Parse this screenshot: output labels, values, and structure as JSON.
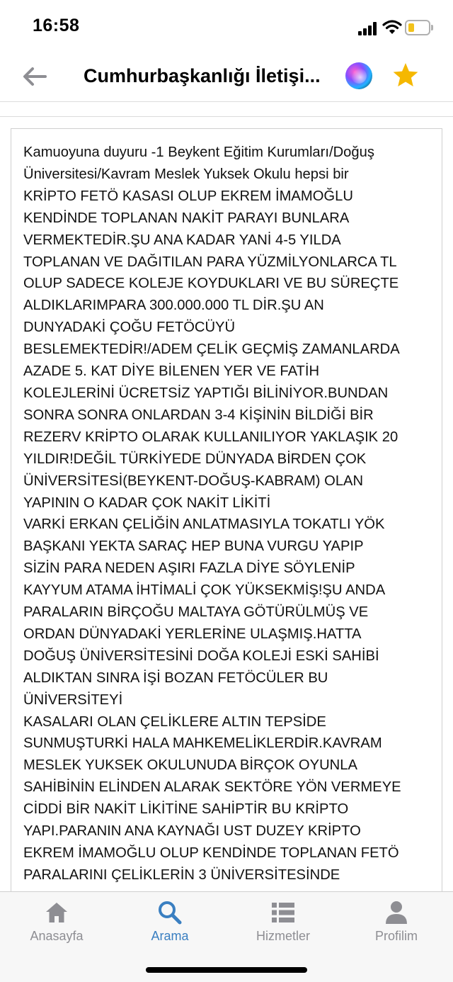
{
  "status_bar": {
    "time": "16:58",
    "battery_color": "#f2c21b"
  },
  "nav": {
    "back_icon": "back-arrow-icon",
    "title": "Cumhurbaşkanlığı İletişi...",
    "siri_icon": "siri-icon",
    "favorite_icon": "star-icon",
    "star_color": "#f5b800"
  },
  "content": {
    "text": "Kamuoyuna duyuru -1 Beykent Eğitim Kurumları/Doğuş\nÜniversitesi/Kavram Meslek Yuksek Okulu hepsi bir\nKRİPTO FETÖ KASASI OLUP EKREM İMAMOĞLU\nKENDİNDE TOPLANAN NAKİT PARAYI BUNLARA\nVERMEKTEDİR.ŞU ANA KADAR YANİ 4-5 YILDA\nTOPLANAN VE DAĞITILAN PARA YÜZMİLYONLARCA TL\nOLUP SADECE KOLEJE KOYDUKLARI VE BU SÜREÇTE\nALDIKLARIMPARA 300.000.000 TL DİR.ŞU AN\nDUNYADAKİ ÇOĞU FETÖCÜYÜ\nBESLEMEKTEDİR!/ADEM ÇELİK GEÇMİŞ ZAMANLARDA\nAZADE 5. KAT DİYE BİLENEN YER VE FATİH\nKOLEJLERİNİ ÜCRETSİZ YAPTIĞI BİLİNİYOR.BUNDAN\nSONRA SONRA ONLARDAN 3-4 KİŞİNİN BİLDİĞİ BİR\nREZERV KRİPTO OLARAK KULLANILIYOR YAKLAŞIK 20\nYILDIR!DEĞİL TÜRKİYEDE DÜNYADA BİRDEN ÇOK\nÜNİVERSİTESİ(BEYKENT-DOĞUŞ-KABRAM) OLAN\nYAPININ O KADAR ÇOK NAKİT LİKİTİ\nVARKİ ERKAN ÇELİĞİN ANLATMASIYLA TOKATLI YÖK\nBAŞKANI YEKTA SARAÇ HEP BUNA VURGU YAPIP\nSİZİN PARA NEDEN AŞIRI FAZLA DİYE SÖYLENİP\nKAYYUM ATAMA İHTİMALİ ÇOK YÜKSEKMİŞ!ŞU ANDA\nPARALARIN BİRÇOĞU MALTAYA GÖTÜRÜLMÜŞ VE\nORDAN DÜNYADAKİ YERLERİNE ULAŞMIŞ.HATTA\nDOĞUŞ ÜNİVERSİTESİNİ DOĞA KOLEJİ ESKİ SAHİBİ\nALDIKTAN SINRA İŞİ BOZAN FETÖCÜLER BU\nÜNİVERSİTEYİ\nKASALARI OLAN ÇELİKLERE ALTIN TEPSİDE\nSUNMUŞTURKİ HALA MAHKEMELİKLERDİR.KAVRAM\nMESLEK YUKSEK OKULUNUDA BİRÇOK OYUNLA\nSAHİBİNİN ELİNDEN ALARAK SEKTÖRE YÖN VERMEYE\nCİDDİ BİR NAKİT LİKİTİNE SAHİPTİR BU KRİPTO\nYAPI.PARANIN ANA KAYNAĞI UST DUZEY KRİPTO\nEKREM İMAMOĞLU OLUP KENDİNDE TOPLANAN FETÖ\nPARALARINI ÇELİKLERİN 3 ÜNİVERSİTESİNDE"
  },
  "tabs": [
    {
      "label": "Anasayfa",
      "icon": "home-icon",
      "active": false
    },
    {
      "label": "Arama",
      "icon": "search-icon",
      "active": true
    },
    {
      "label": "Hizmetler",
      "icon": "list-icon",
      "active": false
    },
    {
      "label": "Profilim",
      "icon": "profile-icon",
      "active": false
    }
  ],
  "colors": {
    "accent": "#3a7fc1",
    "inactive": "#8e8e93"
  }
}
